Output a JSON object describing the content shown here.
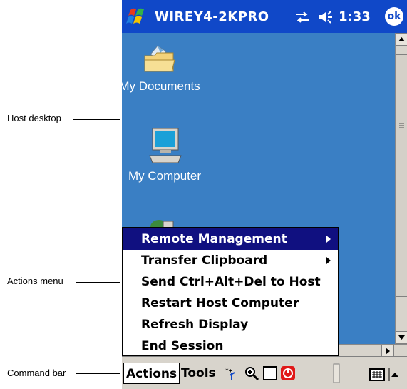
{
  "callouts": {
    "host_desktop": "Host desktop",
    "actions_menu": "Actions menu",
    "command_bar": "Command bar"
  },
  "titlebar": {
    "title": "WIREY4-2KPRO",
    "time": "1:33",
    "ok_label": "ok",
    "icons": [
      "windows-start-icon",
      "connectivity-icon",
      "volume-icon"
    ]
  },
  "desktop": {
    "icons": [
      {
        "label": "My Documents",
        "icon": "folder-icon"
      },
      {
        "label": "My Computer",
        "icon": "computer-icon"
      }
    ]
  },
  "actions_menu": {
    "items": [
      {
        "label": "Remote Management",
        "submenu": true,
        "selected": true
      },
      {
        "label": "Transfer Clipboard",
        "submenu": true,
        "selected": false
      },
      {
        "label": "Send Ctrl+Alt+Del to Host",
        "submenu": false,
        "selected": false
      },
      {
        "label": "Restart Host Computer",
        "submenu": false,
        "selected": false
      },
      {
        "label": "Refresh Display",
        "submenu": false,
        "selected": false
      },
      {
        "label": "End Session",
        "submenu": false,
        "selected": false
      }
    ]
  },
  "command_bar": {
    "menus": [
      {
        "label": "Actions"
      },
      {
        "label": "Tools"
      }
    ],
    "icons": [
      "keyboard-shortcut-icon",
      "zoom-icon",
      "fullscreen-icon",
      "disconnect-icon",
      "scroll-icon",
      "keyboard-icon",
      "sip-arrow-icon"
    ]
  },
  "colors": {
    "titlebar": "#1048c8",
    "desktop": "#3a7fc4",
    "menu_selected": "#101080",
    "bar": "#d8d4cc"
  }
}
